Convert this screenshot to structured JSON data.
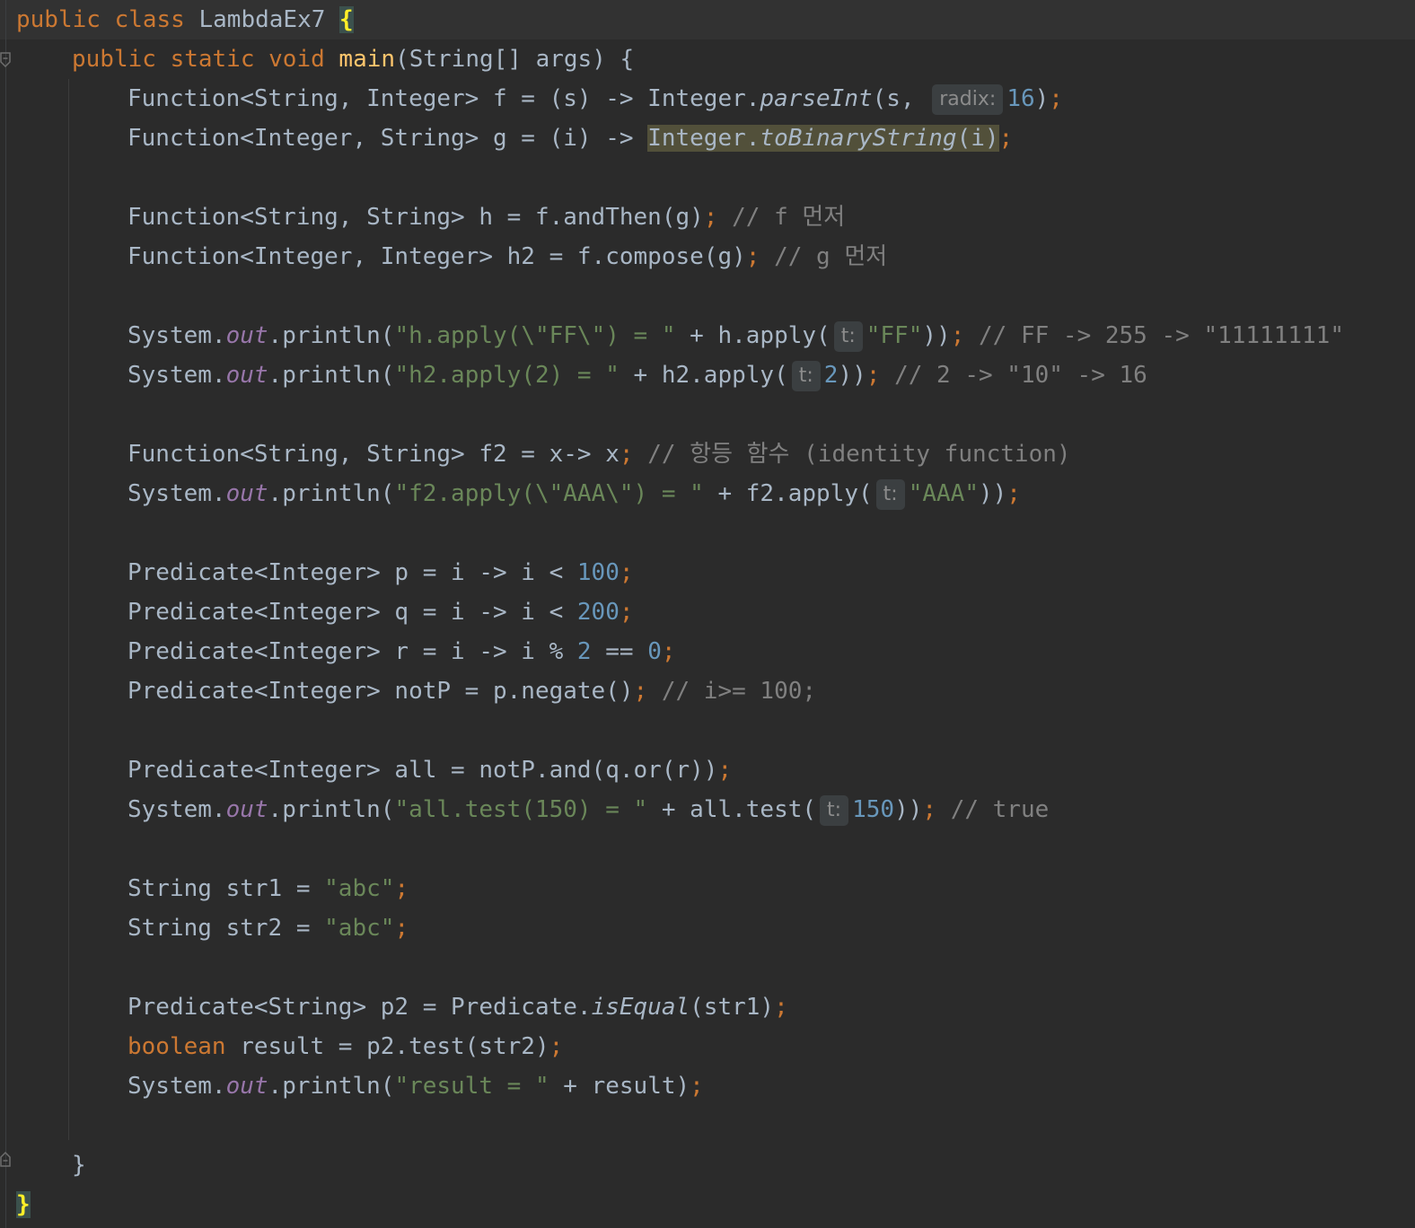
{
  "editor": {
    "colors": {
      "background": "#2b2b2b",
      "keyword": "#cc7832",
      "string": "#6a8759",
      "number": "#6897bb",
      "comment": "#808080",
      "method_declaration": "#ffc66d",
      "static_field": "#9876aa",
      "text": "#a9b7c6"
    },
    "code": {
      "class_name": "LambdaEx7",
      "main_name": "main",
      "main_params": "(String[] args) {",
      "f_decl": "Function<String, Integer> f = (s) -> Integer.",
      "f_call": "parseInt",
      "f_args": "(s, ",
      "radix_hint": "radix:",
      "radix_value": "16",
      "g_decl": "Function<Integer, String> g = (i) -> ",
      "g_call_class": "Integer.",
      "g_call": "toBinaryString",
      "g_args": "(i)",
      "h_decl": "Function<String, String> h = f.andThen(g)",
      "h_comment": "// f 먼저",
      "h2_decl": "Function<Integer, Integer> h2 = f.compose(g)",
      "h2_comment": "// g 먼저",
      "println1_str": "\"h.apply(\\\"FF\\\") = \"",
      "println1_mid": " + h.apply(",
      "hint_t": "t:",
      "println1_arg": "\"FF\"",
      "println1_comment": "// FF -> 255 -> \"11111111\"",
      "println2_str": "\"h2.apply(2) = \"",
      "println2_mid": " + h2.apply(",
      "println2_arg": "2",
      "println2_comment": "// 2 -> \"10\" -> 16",
      "f2_decl": "Function<String, String> f2 = x-> x",
      "f2_comment": "// 항등 함수 (identity function)",
      "println3_str": "\"f2.apply(\\\"AAA\\\") = \"",
      "println3_mid": " + f2.apply(",
      "println3_arg": "\"AAA\"",
      "p_decl": "Predicate<Integer> p = i -> i < ",
      "p_num": "100",
      "q_decl": "Predicate<Integer> q = i -> i < ",
      "q_num": "200",
      "r_decl": "Predicate<Integer> r = i -> i % ",
      "r_num1": "2",
      "r_eq": " == ",
      "r_num2": "0",
      "notP_decl": "Predicate<Integer> notP = p.negate()",
      "notP_comment": "// i>= 100;",
      "all_decl": "Predicate<Integer> all = notP.and(q.or(r))",
      "println4_str": "\"all.test(150) = \"",
      "println4_mid": " + all.test(",
      "println4_arg": "150",
      "println4_comment": "// true",
      "str1_decl": "String str1 = ",
      "str2_decl": "String str2 = ",
      "abc": "\"abc\"",
      "p2_decl": "Predicate<String> p2 = Predicate.",
      "p2_call": "isEqual",
      "p2_args": "(str1)",
      "result_type": "boolean",
      "result_decl": " result = p2.test(str2)",
      "println5_str": "\"result = \"",
      "println5_mid": " + result)",
      "system": "System.",
      "out": "out",
      "println_open": ".println(",
      "close2": "))",
      "close1": ")"
    }
  }
}
